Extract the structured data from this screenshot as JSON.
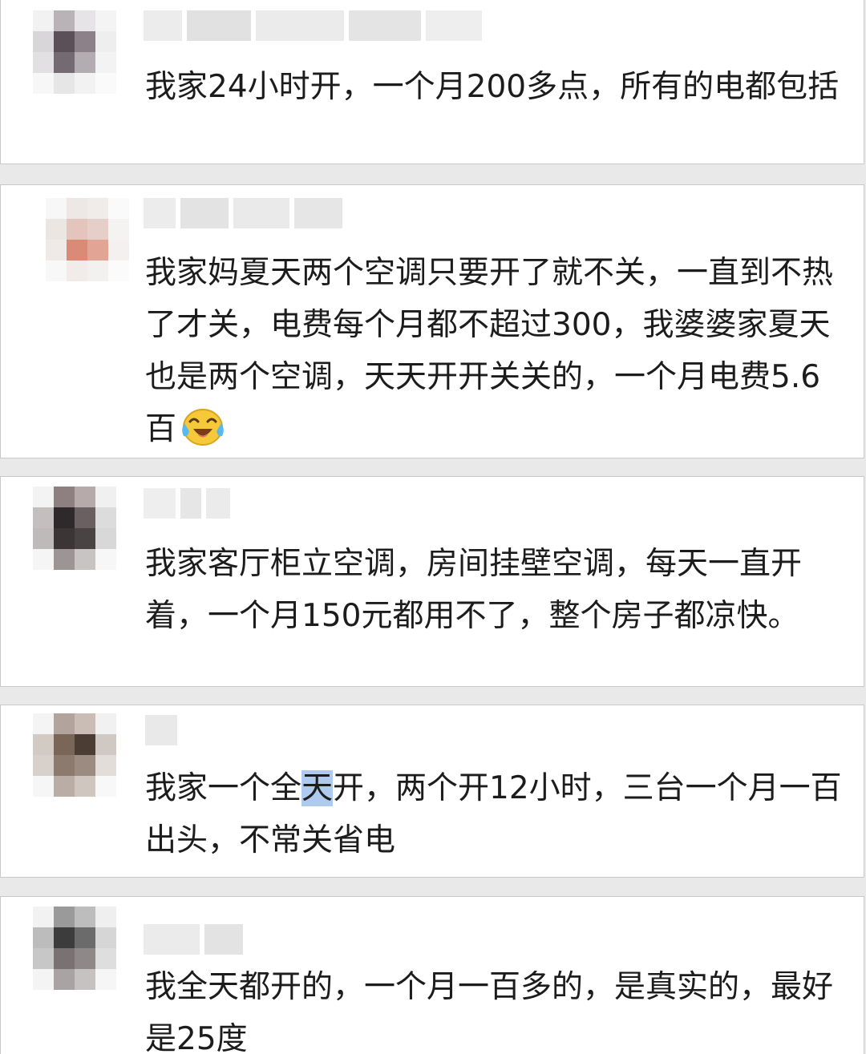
{
  "comments": [
    {
      "username": "",
      "text": "我家24小时开，一个月200多点，所有的电都包括"
    },
    {
      "username": "",
      "text": "我家妈夏天两个空调只要开了就不关，一直到不热了才关，电费每个月都不超过300，我婆婆家夏天也是两个空调，天天开开关关的，一个月电费5.6百",
      "emoji": "crying-laughing-emoji"
    },
    {
      "username": "",
      "text": "我家客厅柜立空调，房间挂壁空调，每天一直开着，一个月150元都用不了，整个房子都凉快。"
    },
    {
      "username": "",
      "text_before": "我家一个全",
      "text_highlight": "天",
      "text_after": "开，两个开12小时，三台一个月一百出头，不常关省电"
    },
    {
      "username": "",
      "text": "我全天都开的，一个月一百多的，是真实的，最好是25度"
    }
  ],
  "colors": {
    "highlight": "#aecbef",
    "card_border": "#c9c9c9",
    "text": "#1c1c1c",
    "background": "#e9e9e9"
  }
}
